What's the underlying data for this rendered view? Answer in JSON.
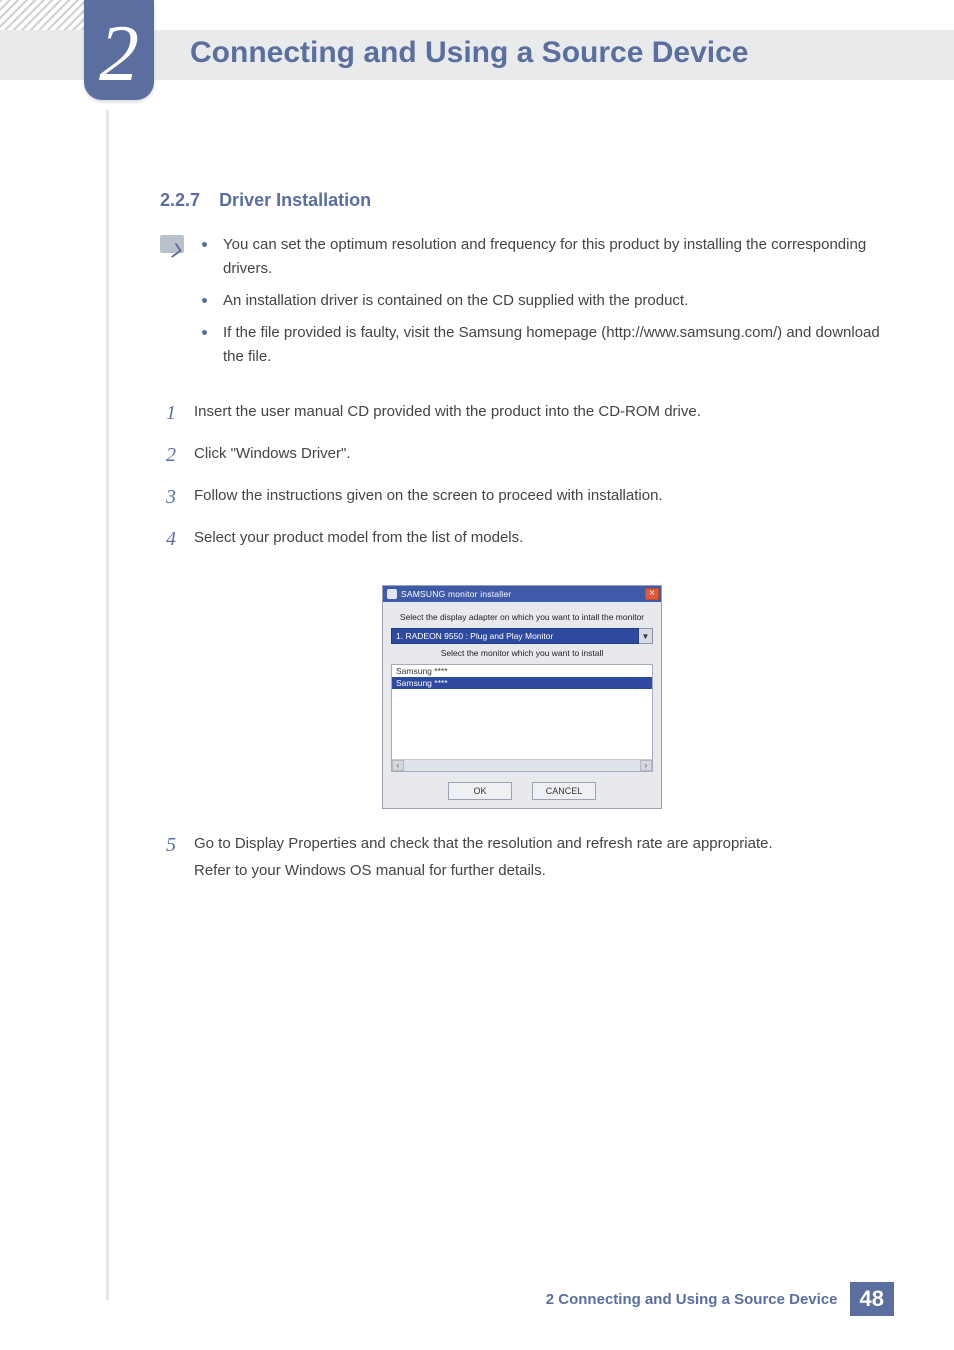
{
  "header": {
    "chapter_number": "2",
    "chapter_title": "Connecting and Using a Source Device"
  },
  "section": {
    "number": "2.2.7",
    "title": "Driver Installation"
  },
  "notes": [
    "You can set the optimum resolution and frequency for this product by installing the corresponding drivers.",
    "An installation driver is contained on the CD supplied with the product.",
    "If the file provided is faulty, visit the Samsung homepage (http://www.samsung.com/) and download the file."
  ],
  "steps": {
    "s1": {
      "n": "1",
      "t": "Insert the user manual CD provided with the product into the CD-ROM drive."
    },
    "s2": {
      "n": "2",
      "t": "Click \"Windows Driver\"."
    },
    "s3": {
      "n": "3",
      "t": "Follow the instructions given on the screen to proceed with installation."
    },
    "s4": {
      "n": "4",
      "t": "Select your product model from the list of models."
    },
    "s5": {
      "n": "5",
      "t": "Go to Display Properties and check that the resolution and refresh rate are appropriate."
    },
    "s5b": "Refer to your Windows OS manual for further details."
  },
  "installer": {
    "title": "SAMSUNG monitor installer",
    "close": "×",
    "label_adapter": "Select the display adapter on which you want to intall the monitor",
    "adapter_value": "1. RADEON 9550 : Plug and Play Monitor",
    "dd_glyph": "▼",
    "label_monitor": "Select the monitor which you want to install",
    "rows": {
      "r0": "Samsung ****",
      "r1": "Samsung ****"
    },
    "scroll_left": "‹",
    "scroll_right": "›",
    "ok": "OK",
    "cancel": "CANCEL"
  },
  "footer": {
    "text": "2 Connecting and Using a Source Device",
    "page": "48"
  }
}
